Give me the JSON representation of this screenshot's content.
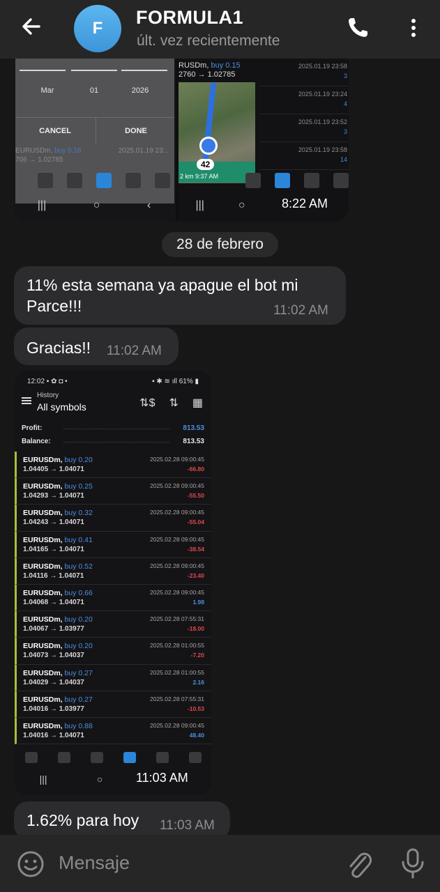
{
  "header": {
    "avatar_letter": "F",
    "title": "FORMULA1",
    "status": "últ. vez recientemente"
  },
  "image_message_1": {
    "left_screenshot": {
      "picker_values": [
        "Mar",
        "01",
        "2026"
      ],
      "cancel": "CANCEL",
      "done": "DONE",
      "row_symbol": "EURUSDm,",
      "row_side": "buy 0.18",
      "row_date": "2025.01.19 23:..",
      "row_prices": "706 → 1.02785"
    },
    "right_screenshot": {
      "top_symbol": "RUSDm,",
      "top_side": "buy 0.15",
      "top_prices": "2760 → 1.02785",
      "map_badge": "42",
      "map_info": "2 km  9:37 AM",
      "rows": [
        {
          "date": "2025.01.19 23:58",
          "value": "3"
        },
        {
          "date": "2025.01.19 23:24",
          "value": "4"
        },
        {
          "date": "2025.01.19 23:52",
          "value": "3"
        },
        {
          "date": "2025.01.19 23:58",
          "value": "14"
        }
      ]
    },
    "time": "8:22 AM"
  },
  "date_separator": "28 de febrero",
  "messages": [
    {
      "text": "11% esta semana ya apague el bot mi Parce!!!",
      "time": "11:02 AM"
    },
    {
      "text": "Gracias!!",
      "time": "11:02 AM"
    }
  ],
  "image_message_2": {
    "status_time": "12:02",
    "status_right": "61%",
    "title": "History",
    "subtitle": "All symbols",
    "profit_label": "Profit:",
    "profit_value": "813.53",
    "balance_label": "Balance:",
    "balance_value": "813.53",
    "trades": [
      {
        "symbol": "EURUSDm,",
        "side": "buy 0.20",
        "prices": "1.04405 → 1.04071",
        "date": "2025.02.28 09:00:45",
        "pl": "-66.80",
        "sign": "neg"
      },
      {
        "symbol": "EURUSDm,",
        "side": "buy 0.25",
        "prices": "1.04293 → 1.04071",
        "date": "2025.02.28 09:00:45",
        "pl": "-55.50",
        "sign": "neg"
      },
      {
        "symbol": "EURUSDm,",
        "side": "buy 0.32",
        "prices": "1.04243 → 1.04071",
        "date": "2025.02.28 09:00:45",
        "pl": "-55.04",
        "sign": "neg"
      },
      {
        "symbol": "EURUSDm,",
        "side": "buy 0.41",
        "prices": "1.04165 → 1.04071",
        "date": "2025.02.28 09:00:45",
        "pl": "-38.54",
        "sign": "neg"
      },
      {
        "symbol": "EURUSDm,",
        "side": "buy 0.52",
        "prices": "1.04116 → 1.04071",
        "date": "2025.02.28 09:00:45",
        "pl": "-23.40",
        "sign": "neg"
      },
      {
        "symbol": "EURUSDm,",
        "side": "buy 0.66",
        "prices": "1.04068 → 1.04071",
        "date": "2025.02.28 09:00:45",
        "pl": "1.98",
        "sign": "pos"
      },
      {
        "symbol": "EURUSDm,",
        "side": "buy 0.20",
        "prices": "1.04067 → 1.03977",
        "date": "2025.02.28 07:55:31",
        "pl": "-18.00",
        "sign": "neg"
      },
      {
        "symbol": "EURUSDm,",
        "side": "buy 0.20",
        "prices": "1.04073 → 1.04037",
        "date": "2025.02.28 01:00:55",
        "pl": "-7.20",
        "sign": "neg"
      },
      {
        "symbol": "EURUSDm,",
        "side": "buy 0.27",
        "prices": "1.04029 → 1.04037",
        "date": "2025.02.28 01:00:55",
        "pl": "2.16",
        "sign": "pos"
      },
      {
        "symbol": "EURUSDm,",
        "side": "buy 0.27",
        "prices": "1.04016 → 1.03977",
        "date": "2025.02.28 07:55:31",
        "pl": "-10.53",
        "sign": "neg"
      },
      {
        "symbol": "EURUSDm,",
        "side": "buy 0.88",
        "prices": "1.04016 → 1.04071",
        "date": "2025.02.28 09:00:45",
        "pl": "48.40",
        "sign": "pos"
      }
    ],
    "time": "11:03 AM"
  },
  "last_message": {
    "text": "1.62% para hoy",
    "time": "11:03 AM"
  },
  "input": {
    "placeholder": "Mensaje"
  },
  "colors": {
    "accent": "#3d95d8",
    "bubble": "#2c2c2e",
    "background": "#171717",
    "loss": "#e0484a",
    "gain": "#4e8fe0"
  }
}
